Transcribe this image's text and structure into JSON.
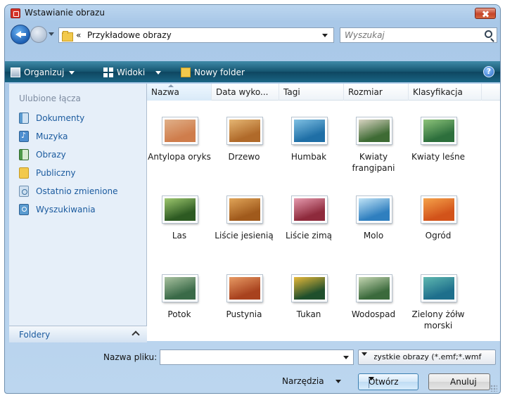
{
  "window": {
    "title": "Wstawianie obrazu"
  },
  "address": {
    "chevron": "«",
    "path": "Przykładowe obrazy"
  },
  "search": {
    "placeholder": "Wyszukaj"
  },
  "toolbar": {
    "organize": "Organizuj",
    "views": "Widoki",
    "new_folder": "Nowy folder"
  },
  "nav": {
    "heading": "Ulubione łącza",
    "items": [
      {
        "label": "Dokumenty",
        "icon": "documents-icon"
      },
      {
        "label": "Muzyka",
        "icon": "music-icon"
      },
      {
        "label": "Obrazy",
        "icon": "pictures-icon"
      },
      {
        "label": "Publiczny",
        "icon": "public-folder-icon"
      },
      {
        "label": "Ostatnio zmienione",
        "icon": "recent-icon"
      },
      {
        "label": "Wyszukiwania",
        "icon": "searches-icon"
      }
    ],
    "folders": "Foldery"
  },
  "columns": [
    "Nazwa",
    "Data wyko...",
    "Tagi",
    "Rozmiar",
    "Klasyfikacja"
  ],
  "files": [
    {
      "name": "Antylopa oryks",
      "colors": [
        "#cf7d4c",
        "#e0b089"
      ]
    },
    {
      "name": "Drzewo",
      "colors": [
        "#b06a2a",
        "#e5b673"
      ]
    },
    {
      "name": "Humbak",
      "colors": [
        "#1f6fa6",
        "#7fc0e3"
      ]
    },
    {
      "name": "Kwiaty frangipani",
      "colors": [
        "#3e6b34",
        "#d9d4c2"
      ]
    },
    {
      "name": "Kwiaty leśne",
      "colors": [
        "#2d6f3c",
        "#8dc37a"
      ]
    },
    {
      "name": "Las",
      "colors": [
        "#2d5a22",
        "#9dc76e"
      ]
    },
    {
      "name": "Liście jesienią",
      "colors": [
        "#a05a1c",
        "#e0a458"
      ]
    },
    {
      "name": "Liście zimą",
      "colors": [
        "#8e2a3c",
        "#e59aae"
      ]
    },
    {
      "name": "Molo",
      "colors": [
        "#2f7fbf",
        "#bfe3f6"
      ]
    },
    {
      "name": "Ogród",
      "colors": [
        "#d2531a",
        "#f5a24a"
      ]
    },
    {
      "name": "Potok",
      "colors": [
        "#3a6a48",
        "#a9c2a0"
      ]
    },
    {
      "name": "Pustynia",
      "colors": [
        "#a8421e",
        "#e79a64"
      ]
    },
    {
      "name": "Tukan",
      "colors": [
        "#1f4f2c",
        "#e6b83a"
      ]
    },
    {
      "name": "Wodospad",
      "colors": [
        "#3b6a3c",
        "#c4d6b2"
      ]
    },
    {
      "name": "Zielony żółw morski",
      "colors": [
        "#1e6f8c",
        "#5fb8b0"
      ]
    }
  ],
  "filename": {
    "label": "Nazwa pliku:",
    "value": ""
  },
  "filter": {
    "value": "Wszystkie obrazy (*.emf;*.wmf"
  },
  "tools": {
    "label": "Narzędzia"
  },
  "buttons": {
    "open": "Otwórz",
    "cancel": "Anuluj"
  }
}
